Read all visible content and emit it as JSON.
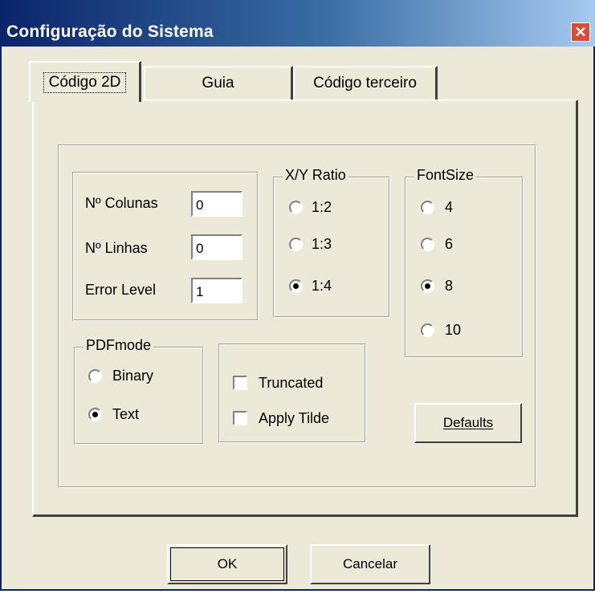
{
  "window": {
    "title": "Configuração do Sistema",
    "close_icon": "close-icon"
  },
  "tabs": [
    {
      "label": "Código 2D",
      "active": true
    },
    {
      "label": "Guia",
      "active": false
    },
    {
      "label": "Código terceiro",
      "active": false
    }
  ],
  "dimensions": {
    "columns_label": "Nº  Colunas",
    "columns_value": "0",
    "rows_label": "Nº Linhas",
    "rows_value": "0",
    "error_label": "Error Level",
    "error_value": "1"
  },
  "xy_ratio": {
    "legend": "X/Y Ratio",
    "options": [
      "1:2",
      "1:3",
      "1:4"
    ],
    "selected": "1:4"
  },
  "font_size": {
    "legend": "FontSize",
    "options": [
      "4",
      "6",
      "8",
      "10"
    ],
    "selected": "8"
  },
  "pdf_mode": {
    "legend": "PDFmode",
    "options": [
      "Binary",
      "Text"
    ],
    "selected": "Text"
  },
  "options": {
    "truncated_label": "Truncated",
    "truncated_checked": false,
    "apply_tilde_label": "Apply Tilde",
    "apply_tilde_checked": false
  },
  "buttons": {
    "defaults_label": "Defaults",
    "ok_label": "OK",
    "cancel_label": "Cancelar"
  }
}
